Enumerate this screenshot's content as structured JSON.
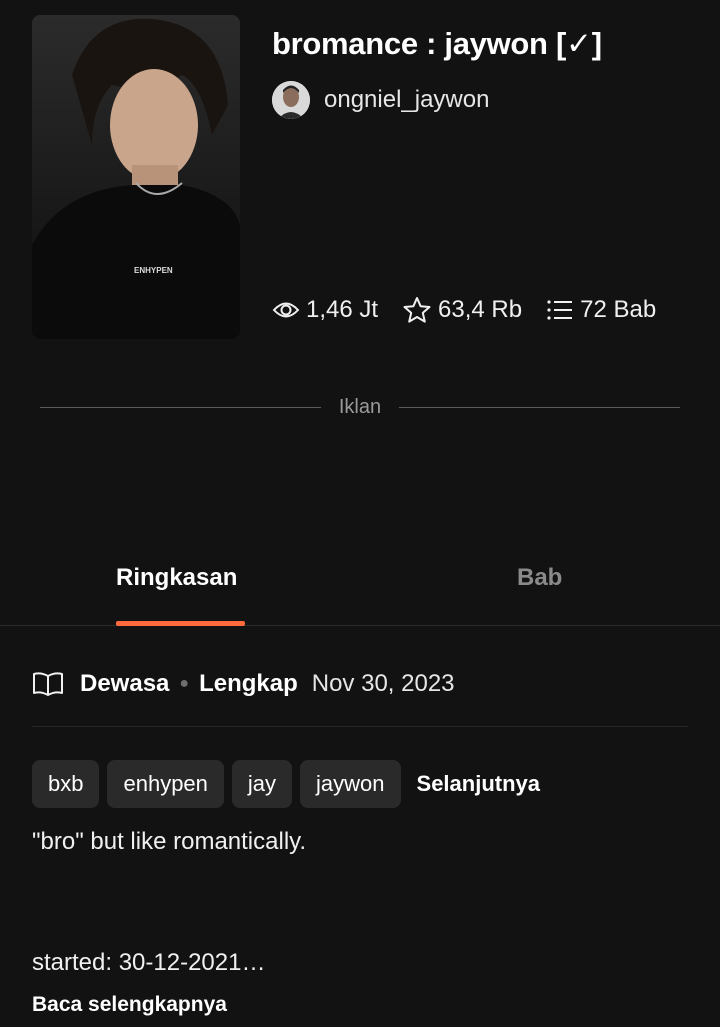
{
  "story": {
    "title": "bromance : jaywon [✓]",
    "author": "ongniel_jaywon",
    "cover_shirt_text": "ENHYPEN"
  },
  "stats": {
    "views": "1,46 Jt",
    "votes": "63,4 Rb",
    "parts": "72 Bab"
  },
  "ad_label": "Iklan",
  "tabs": {
    "summary": "Ringkasan",
    "chapters": "Bab"
  },
  "meta": {
    "rating": "Dewasa",
    "status": "Lengkap",
    "date": "Nov 30, 2023"
  },
  "tags": [
    "bxb",
    "enhypen",
    "jay",
    "jaywon"
  ],
  "tags_more": "Selanjutnya",
  "description": "\"bro\" but like romantically.",
  "started": "started: 30-12-2021…",
  "read_more": "Baca selengkapnya",
  "colors": {
    "background": "#121212",
    "accent": "#ff6a3d",
    "tag_bg": "#2a2a2a"
  },
  "icons": [
    "eye-icon",
    "star-icon",
    "list-icon",
    "book-open-icon"
  ]
}
